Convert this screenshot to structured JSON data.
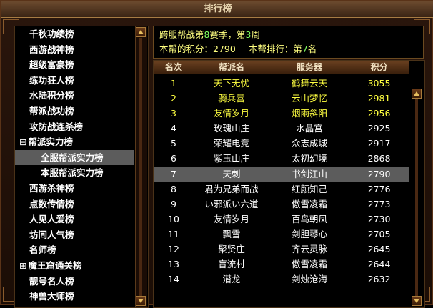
{
  "window": {
    "title": "排行榜"
  },
  "categories": [
    {
      "label": "千秋功绩榜"
    },
    {
      "label": "西游战神榜"
    },
    {
      "label": "超级富豪榜"
    },
    {
      "label": "练功狂人榜"
    },
    {
      "label": "水陆积分榜"
    },
    {
      "label": "帮派战功榜"
    },
    {
      "label": "攻防战连杀榜"
    },
    {
      "label": "帮派实力榜",
      "expander": "⊟"
    },
    {
      "label": "全服帮派实力榜",
      "selected": true,
      "indent": true
    },
    {
      "label": "本服帮派实力榜",
      "indent": true
    },
    {
      "label": "西游杀神榜"
    },
    {
      "label": "点数传情榜"
    },
    {
      "label": "人见人爱榜"
    },
    {
      "label": "坊间人气榜"
    },
    {
      "label": "名师榜"
    },
    {
      "label": "魔王窟通关榜",
      "expander": "⊞"
    },
    {
      "label": "靓号名人榜"
    },
    {
      "label": "神兽大师榜"
    }
  ],
  "info": {
    "line1_prefix": "跨服帮战第",
    "season": "8",
    "line1_mid": "赛季，第",
    "week": "3",
    "line1_suffix": "周",
    "line2_prefix": "本帮的积分：",
    "my_score": "2790",
    "line2_mid": "本帮排行：第",
    "my_rank": "7",
    "line2_suffix": "名"
  },
  "table": {
    "headers": {
      "rank": "名次",
      "guild": "帮派名",
      "server": "服务器",
      "score": "积分"
    },
    "rows": [
      {
        "rank": "1",
        "guild": "天下无忧",
        "server": "鹤舞云天",
        "score": "3055"
      },
      {
        "rank": "2",
        "guild": "骑兵营",
        "server": "云山梦忆",
        "score": "2981"
      },
      {
        "rank": "3",
        "guild": "友情岁月",
        "server": "烟雨斜阳",
        "score": "2956"
      },
      {
        "rank": "4",
        "guild": "玫瑰山庄",
        "server": "水晶宫",
        "score": "2925"
      },
      {
        "rank": "5",
        "guild": "荣耀电竞",
        "server": "众志成城",
        "score": "2917"
      },
      {
        "rank": "6",
        "guild": "紫玉山庄",
        "server": "太初幻境",
        "score": "2868"
      },
      {
        "rank": "7",
        "guild": "天刺",
        "server": "书剑江山",
        "score": "2790"
      },
      {
        "rank": "8",
        "guild": "君为兄弟而战",
        "server": "红颜知己",
        "score": "2776"
      },
      {
        "rank": "9",
        "guild": "い邪派い六道",
        "server": "傲雪凌霜",
        "score": "2773"
      },
      {
        "rank": "10",
        "guild": "友情岁月",
        "server": "百鸟朝凤",
        "score": "2730"
      },
      {
        "rank": "11",
        "guild": "飘雪",
        "server": "剑胆琴心",
        "score": "2705"
      },
      {
        "rank": "12",
        "guild": "聚贤庄",
        "server": "齐云灵脉",
        "score": "2645"
      },
      {
        "rank": "13",
        "guild": "盲流村",
        "server": "傲雪凌霜",
        "score": "2644"
      },
      {
        "rank": "14",
        "guild": "潜龙",
        "server": "剑烛沧海",
        "score": "2632"
      }
    ]
  }
}
